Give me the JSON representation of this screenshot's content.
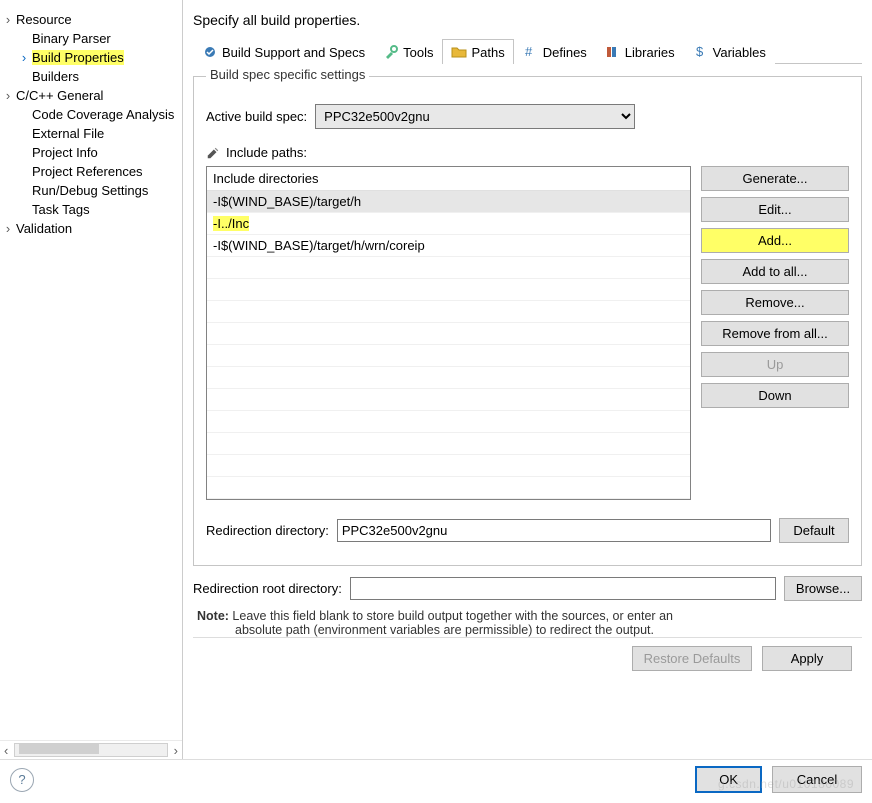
{
  "sidebar": {
    "items": [
      {
        "label": "Resource",
        "expandable": true
      },
      {
        "label": "Binary Parser",
        "child": true
      },
      {
        "label": "Build Properties",
        "child": true,
        "highlight": true,
        "expandable_blue": true
      },
      {
        "label": "Builders",
        "child": true
      },
      {
        "label": "C/C++ General",
        "expandable": true
      },
      {
        "label": "Code Coverage Analysis",
        "child": true
      },
      {
        "label": "External File",
        "child": true
      },
      {
        "label": "Project Info",
        "child": true
      },
      {
        "label": "Project References",
        "child": true
      },
      {
        "label": "Run/Debug Settings",
        "child": true
      },
      {
        "label": "Task Tags",
        "child": true
      },
      {
        "label": "Validation",
        "expandable": true
      }
    ]
  },
  "heading": "Specify all build properties.",
  "tabs": [
    {
      "label": "Build Support and Specs",
      "icon": "gear-check-icon"
    },
    {
      "label": "Tools",
      "icon": "tool-icon"
    },
    {
      "label": "Paths",
      "icon": "folder-icon",
      "active": true,
      "highlight": true
    },
    {
      "label": "Defines",
      "icon": "hash-icon"
    },
    {
      "label": "Libraries",
      "icon": "books-icon"
    },
    {
      "label": "Variables",
      "icon": "dollar-icon"
    }
  ],
  "buildspec": {
    "legend": "Build spec specific settings",
    "activeLabel": "Active build spec:",
    "activeValue": "PPC32e500v2gnu",
    "includeHeading": "Include paths:",
    "listHeader": "Include directories",
    "entries": [
      {
        "text": "-I$(WIND_BASE)/target/h",
        "sel": true
      },
      {
        "text": "-I../Inc",
        "highlight": true
      },
      {
        "text": "-I$(WIND_BASE)/target/h/wrn/coreip"
      }
    ],
    "buttons": {
      "generate": "Generate...",
      "edit": "Edit...",
      "add": "Add...",
      "addAll": "Add to all...",
      "remove": "Remove...",
      "removeAll": "Remove from all...",
      "up": "Up",
      "down": "Down"
    }
  },
  "redir": {
    "dirLabel": "Redirection directory:",
    "dirValue": "PPC32e500v2gnu",
    "default": "Default",
    "rootLabel": "Redirection root directory:",
    "rootValue": "",
    "browse": "Browse..."
  },
  "note": {
    "bold": "Note:",
    "text1": " Leave this field blank to store build output together with the sources, or enter an",
    "text2": "absolute path (environment variables are permissible) to redirect the output."
  },
  "footer": {
    "restore": "Restore Defaults",
    "apply": "Apply",
    "ok": "OK",
    "cancel": "Cancel"
  },
  "watermark": "g.csdn.net/u010186089"
}
